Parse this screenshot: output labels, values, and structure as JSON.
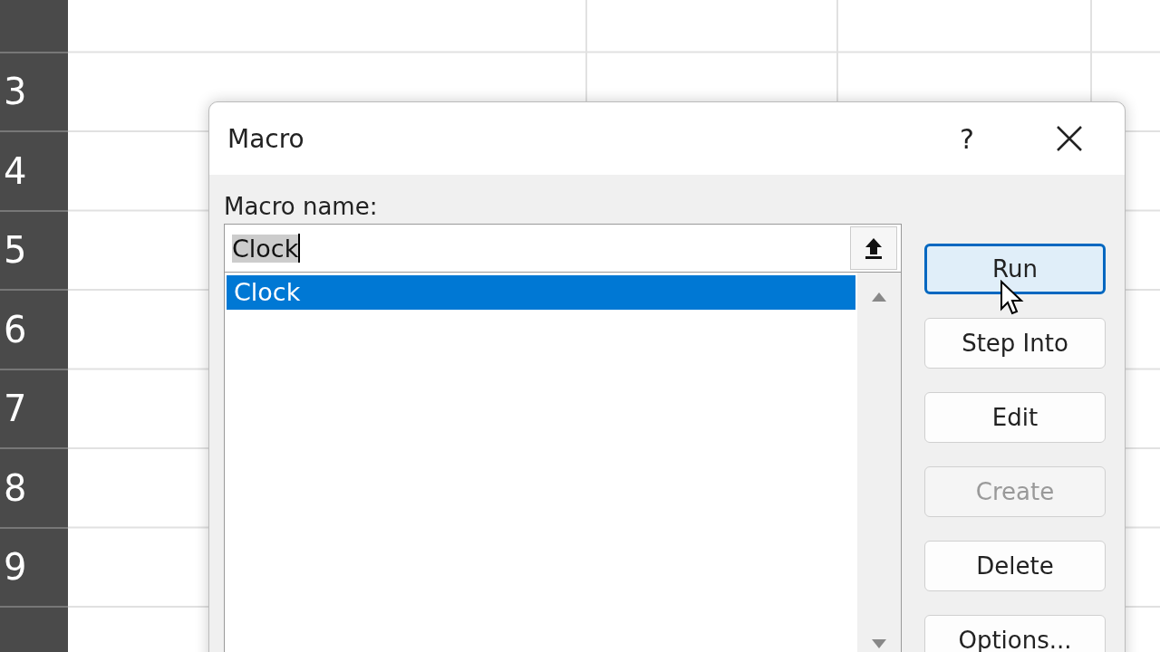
{
  "row_headers": [
    "3",
    "4",
    "5",
    "6",
    "7",
    "8",
    "9"
  ],
  "dialog": {
    "title": "Macro",
    "help_button": "?",
    "name_label": "Macro name:",
    "name_field": {
      "value": "Clock",
      "selected": true
    },
    "macros": [
      {
        "label": "Clock",
        "selected": true
      }
    ],
    "buttons": [
      {
        "label": "Run",
        "focused": true,
        "disabled": false
      },
      {
        "label": "Step Into",
        "focused": false,
        "disabled": false
      },
      {
        "label": "Edit",
        "focused": false,
        "disabled": false
      },
      {
        "label": "Create",
        "focused": false,
        "disabled": true
      },
      {
        "label": "Delete",
        "focused": false,
        "disabled": false
      },
      {
        "label": "Options...",
        "focused": false,
        "disabled": false
      }
    ]
  }
}
